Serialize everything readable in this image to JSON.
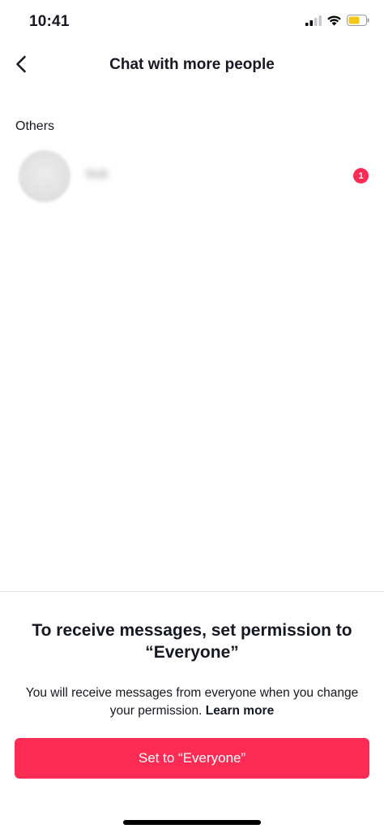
{
  "status_bar": {
    "time": "10:41",
    "icons": [
      "cellular-signal-icon",
      "wifi-icon",
      "battery-icon"
    ],
    "battery_color": "#f5c518"
  },
  "nav": {
    "title": "Chat with more people",
    "back_icon": "chevron-left-icon"
  },
  "section": {
    "header": "Others",
    "contacts": [
      {
        "name": "lindi",
        "unread_count": "1"
      }
    ]
  },
  "sheet": {
    "title": "To receive messages, set permission to “Everyone”",
    "description": "You will receive messages from everyone when you change your permission.",
    "learn_more": "Learn more",
    "button_label": "Set to “Everyone”"
  },
  "colors": {
    "accent": "#fe2c55",
    "text": "#161823",
    "divider": "#e1e1e3"
  }
}
